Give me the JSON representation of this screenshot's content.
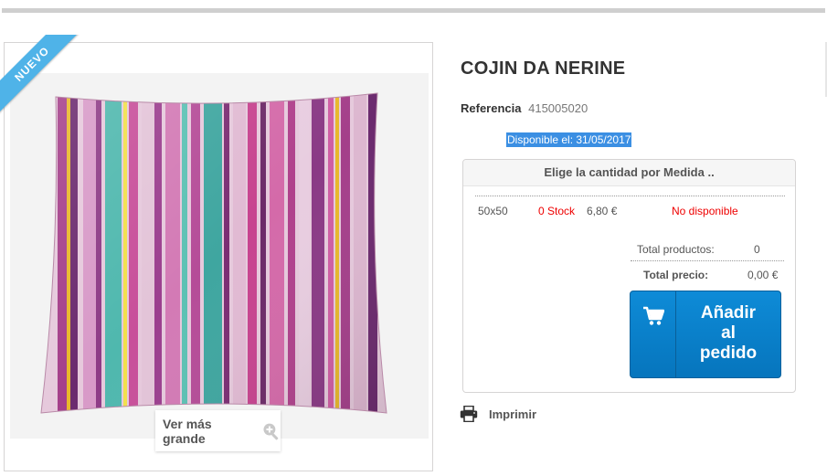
{
  "badge": {
    "label": "NUEVO"
  },
  "image": {
    "alt": "Cojin Da Nerine",
    "view_larger_label": "Ver más grande"
  },
  "product": {
    "title": "COJIN DA NERINE",
    "reference_label": "Referencia",
    "reference_value": "415005020",
    "availability": "Disponible el: 31/05/2017"
  },
  "quantity_panel": {
    "header": "Elige la cantidad por Medida ..",
    "rows": [
      {
        "size": "50x50",
        "stock": "0 Stock",
        "price": "6,80 €",
        "status": "No disponible"
      }
    ],
    "total_products_label": "Total productos:",
    "total_products_value": "0",
    "total_price_label": "Total precio:",
    "total_price_value": "0,00 €",
    "add_button_lines": [
      "Añadir",
      "al",
      "pedido"
    ]
  },
  "print": {
    "label": "Imprimir"
  },
  "colors": {
    "accent": "#0675bd",
    "badge": "#4fb3e8",
    "error": "#ee0000",
    "highlight": "#3b8fe3"
  },
  "icons": {
    "cart": "cart-icon",
    "print": "print-icon",
    "zoom": "zoom-icon"
  }
}
